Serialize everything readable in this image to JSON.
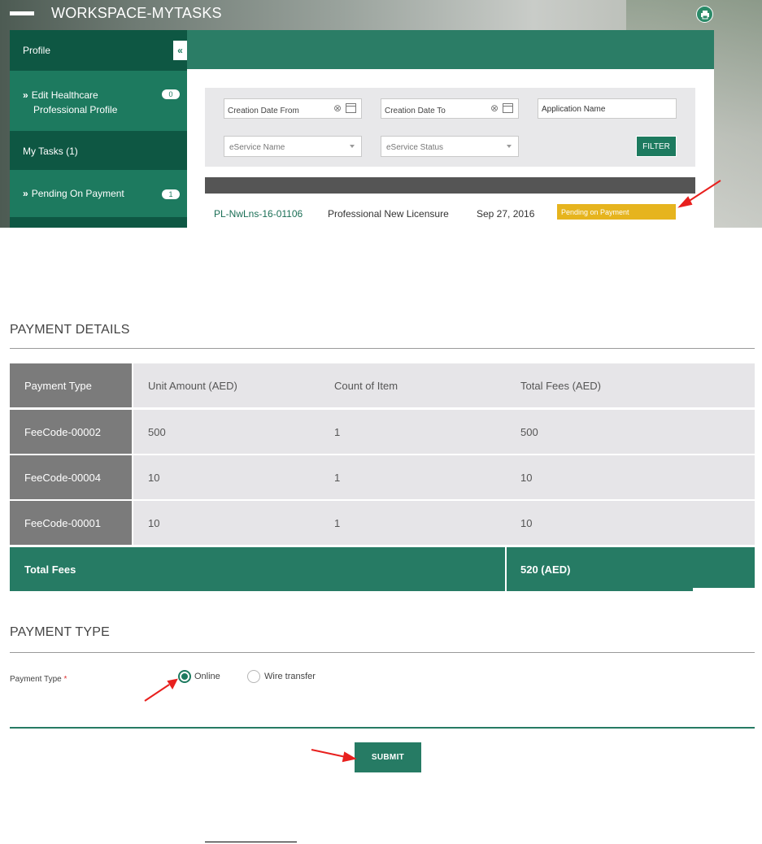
{
  "workspace": {
    "title": "WORKSPACE-MYTASKS"
  },
  "sidebar": {
    "profile_label": "Profile",
    "collapse_glyph": "«",
    "edit_item": {
      "line1": "Edit Healthcare",
      "line2": "Professional Profile",
      "badge": "0"
    },
    "tasks_label": "My Tasks (1)",
    "pending_item": {
      "label": "Pending On Payment",
      "badge": "1"
    },
    "item_arrow_glyph": "»"
  },
  "filters": {
    "creation_date_from": "Creation Date From",
    "creation_date_to": "Creation Date To",
    "application_name": "Application Name",
    "eservice_name": "eService Name",
    "eservice_status": "eService Status",
    "filter_button": "FILTER"
  },
  "results": [
    {
      "id": "PL-NwLns-16-01106",
      "type": "Professional New Licensure",
      "date": "Sep 27, 2016",
      "status": "Pending on Payment"
    }
  ],
  "payment_details": {
    "title": "PAYMENT DETAILS",
    "headers": [
      "Payment Type",
      "Unit Amount (AED)",
      "Count of Item",
      "Total Fees (AED)"
    ],
    "rows": [
      {
        "code": "FeeCode-00002",
        "unit": "500",
        "count": "1",
        "total": "500"
      },
      {
        "code": "FeeCode-00004",
        "unit": "10",
        "count": "1",
        "total": "10"
      },
      {
        "code": "FeeCode-00001",
        "unit": "10",
        "count": "1",
        "total": "10"
      }
    ],
    "total_label": "Total Fees",
    "total_value": "520 (AED)"
  },
  "payment_type": {
    "title": "PAYMENT TYPE",
    "label": "Payment Type",
    "required_mark": "*",
    "options": [
      {
        "label": "Online",
        "selected": true
      },
      {
        "label": "Wire transfer",
        "selected": false
      }
    ]
  },
  "submit_label": "SUBMIT",
  "colors": {
    "brand_green": "#1d7a5f",
    "dark_green": "#0e5743",
    "status_yellow": "#e6b41e",
    "annotation_red": "#e8201e"
  },
  "icons": [
    "menu-icon",
    "printer-icon",
    "clear-icon",
    "calendar-icon",
    "chevron-down-icon"
  ]
}
